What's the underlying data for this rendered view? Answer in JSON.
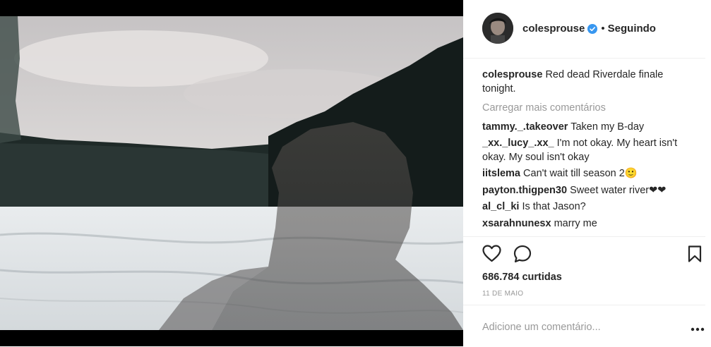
{
  "post": {
    "username": "colesprouse",
    "follow_separator": "•",
    "follow_label": "Seguindo",
    "caption": {
      "username": "colesprouse",
      "text": "Red dead Riverdale finale tonight."
    },
    "load_more": "Carregar mais comentários",
    "comments": [
      {
        "username": "tammy._.takeover",
        "text": "Taken my B-day"
      },
      {
        "username": "_xx._lucy_.xx_",
        "text": "I'm not okay. My heart isn't okay. My soul isn't okay"
      },
      {
        "username": "iitslema",
        "text": "Can't wait till season 2🙂"
      },
      {
        "username": "payton.thigpen30",
        "text": "Sweet water river❤❤"
      },
      {
        "username": "al_cl_ki",
        "text": "Is that Jason?"
      },
      {
        "username": "xsarahnunesx",
        "text": "marry me"
      }
    ],
    "likes": "686.784 curtidas",
    "date": "11 DE MAIO",
    "comment_placeholder": "Adicione um comentário...",
    "icons": {
      "like": "heart-icon",
      "comment": "comment-bubble-icon",
      "save": "bookmark-icon",
      "verified": "verified-badge-icon",
      "more": "more-options-icon"
    },
    "colors": {
      "verified": "#3897f0",
      "muted": "#999999",
      "text": "#262626"
    }
  }
}
